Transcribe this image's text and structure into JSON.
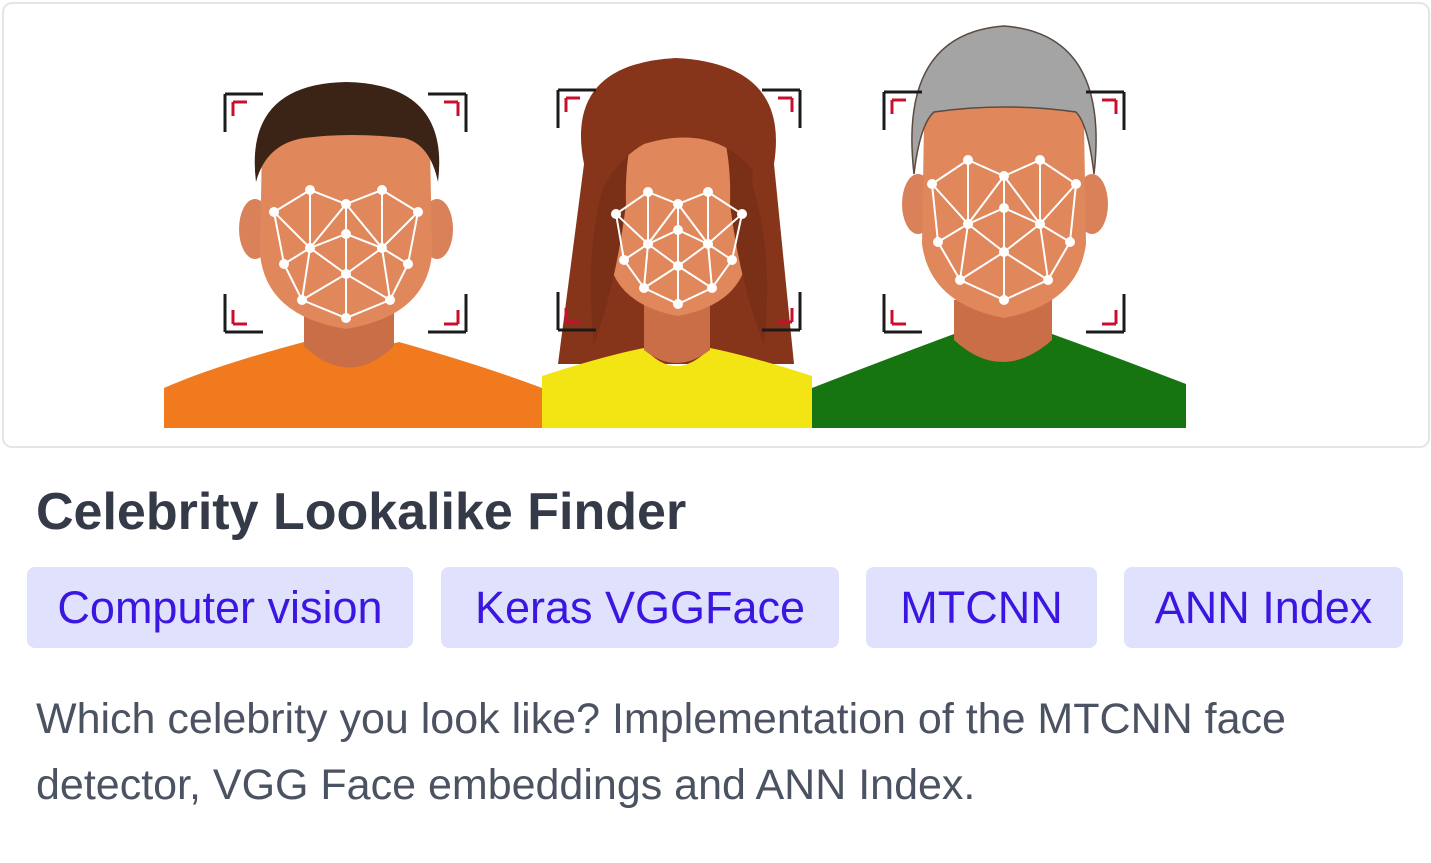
{
  "card": {
    "title": "Celebrity Lookalike Finder",
    "tags": [
      "Computer vision",
      "Keras VGGFace",
      "MTCNN",
      "ANN Index"
    ],
    "description": "Which celebrity you look like? Implementation of the MTCNN face detector, VGG Face embeddings and ANN Index."
  },
  "illustration": {
    "icon": "face-recognition-illustration",
    "people": [
      {
        "name": "man-dark-hair",
        "hair": "#3b2316",
        "shirt": "#f07a1d"
      },
      {
        "name": "woman-red-hair",
        "hair": "#86341a",
        "shirt": "#f3e414"
      },
      {
        "name": "man-grey-hair",
        "hair": "#a4a4a4",
        "shirt": "#167510"
      }
    ],
    "skin": "#e0875c",
    "skin_shadow": "#cf7550",
    "mesh_color": "#ffffff",
    "bracket_dark": "#1b1b1b",
    "bracket_red": "#c8102e"
  },
  "colors": {
    "title": "#343a47",
    "tag_bg": "#e0e1fc",
    "tag_text": "#3a16e0",
    "desc": "#4b5261",
    "frame_border": "#e3e5ea"
  }
}
